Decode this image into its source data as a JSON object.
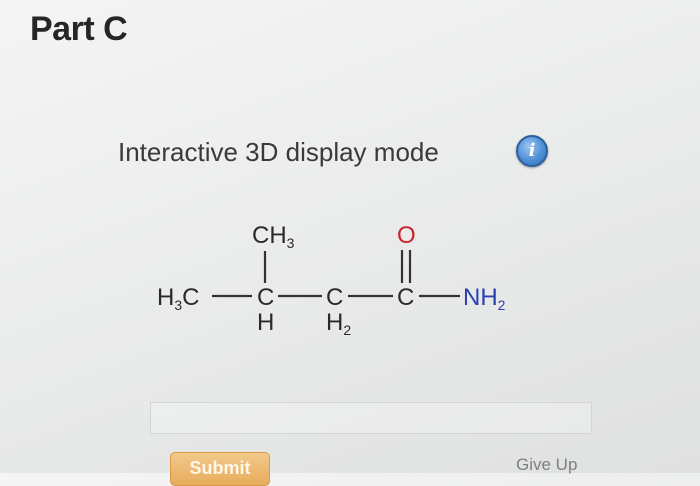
{
  "part": {
    "title": "Part C"
  },
  "display_mode": {
    "label": "Interactive 3D display mode",
    "info_icon_text": "i"
  },
  "molecule": {
    "atoms": {
      "h3c": {
        "main": "H",
        "sub": "3",
        "tail": "C"
      },
      "ch3": {
        "main": "CH",
        "sub": "3"
      },
      "c1": "C",
      "h1": "H",
      "c2": "C",
      "h2": {
        "main": "H",
        "sub": "2"
      },
      "c3": "C",
      "o": "O",
      "nh2": {
        "main": "NH",
        "sub": "2"
      }
    },
    "colors": {
      "carbon_hydrogen": "#2a2a2a",
      "oxygen": "#c8242c",
      "nitrogen": "#2a3fb0"
    }
  },
  "actions": {
    "submit_label": "Submit",
    "give_up_label": "Give Up"
  }
}
